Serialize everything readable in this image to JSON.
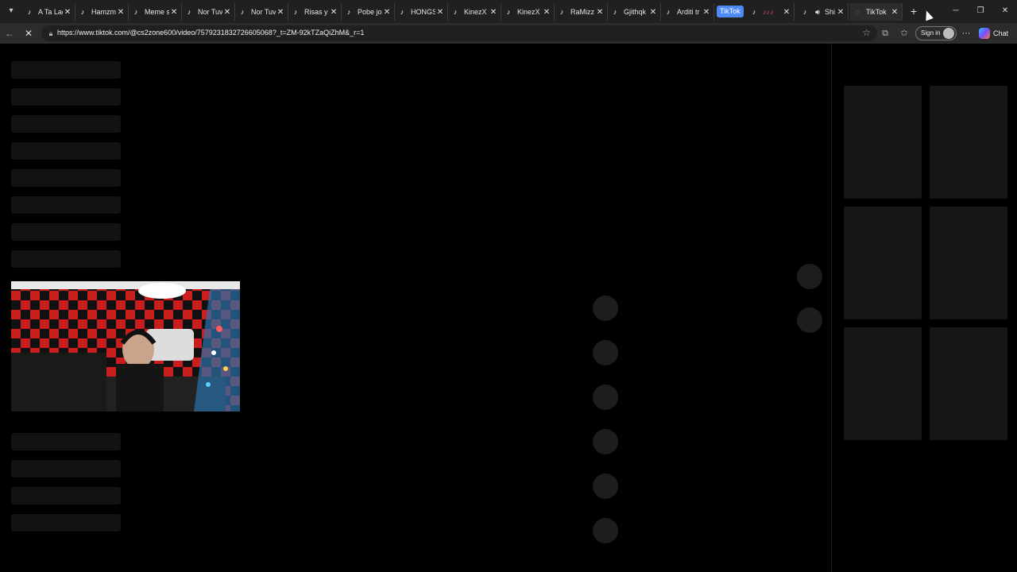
{
  "tabs": [
    {
      "title": "A Ta Lag",
      "favicon": "tiktok-icon"
    },
    {
      "title": "Hamzm",
      "favicon": "tiktok-icon"
    },
    {
      "title": "Meme s",
      "favicon": "tiktok-icon"
    },
    {
      "title": "Nor Tuv",
      "favicon": "tiktok-icon"
    },
    {
      "title": "Nor Tuv",
      "favicon": "tiktok-icon"
    },
    {
      "title": "Risas y",
      "favicon": "tiktok-icon"
    },
    {
      "title": "Pobe joi",
      "favicon": "tiktok-icon"
    },
    {
      "title": "HONGS",
      "favicon": "tiktok-icon"
    },
    {
      "title": "KinezX",
      "favicon": "tiktok-icon"
    },
    {
      "title": "KinezX",
      "favicon": "tiktok-icon"
    },
    {
      "title": "RaMizz",
      "favicon": "tiktok-icon"
    },
    {
      "title": "Gjithqk",
      "favicon": "tiktok-icon"
    },
    {
      "title": "Arditi tr",
      "favicon": "tiktok-icon"
    }
  ],
  "tab_group_label": "TikTok",
  "group_tabs": [
    {
      "title": "♪♪♪",
      "favicon": "tiktok-icon"
    },
    {
      "title": "Shi",
      "favicon": "tiktok-icon"
    }
  ],
  "active_tab": {
    "title": "TikTok",
    "favicon": "loading-spinner-icon"
  },
  "toolbar": {
    "url": "https://www.tiktok.com/@cs2zone600/video/7579231832726605068?_t=ZM-92kTZaQiZhM&_r=1",
    "signin_label": "Sign in",
    "chat_label": "Chat"
  },
  "colors": {
    "tab_group_accent": "#4c8bf5",
    "page_background": "#000000",
    "skeleton": "#121212"
  },
  "webcam_overlay": {
    "description_icon": "webcam-feed"
  }
}
